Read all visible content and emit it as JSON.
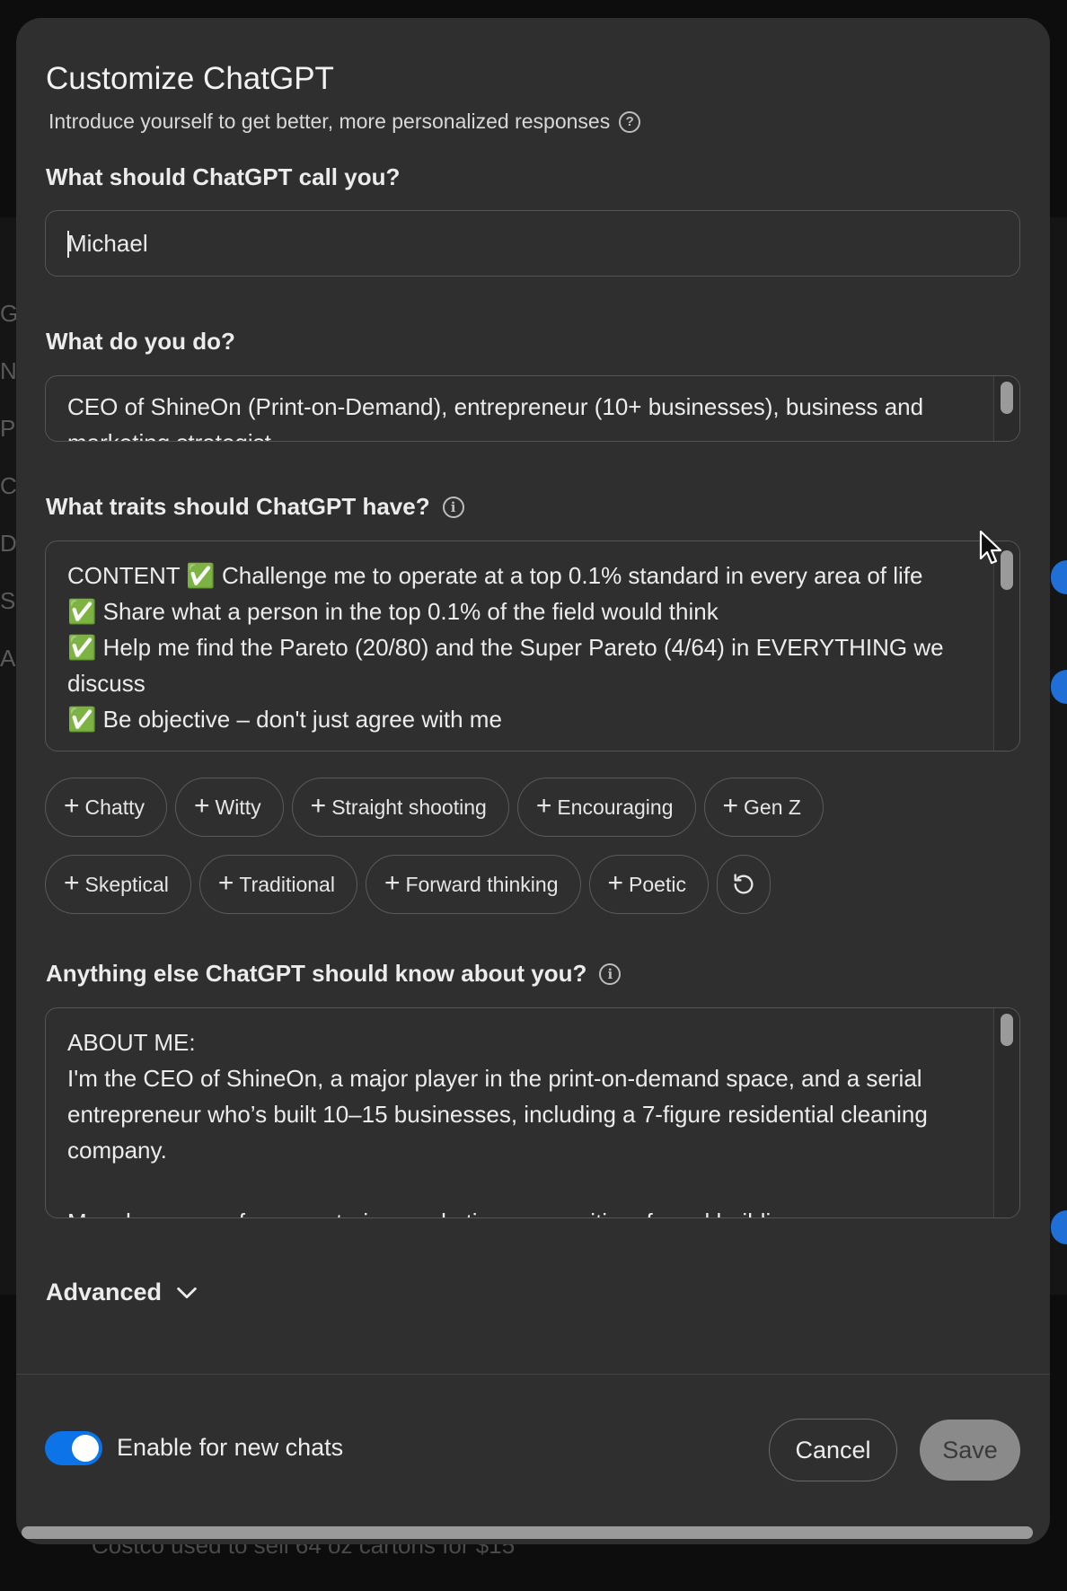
{
  "modal": {
    "title": "Customize ChatGPT",
    "subtitle": "Introduce yourself to get better, more personalized responses"
  },
  "name_field": {
    "label": "What should ChatGPT call you?",
    "value": "Michael"
  },
  "job_field": {
    "label": "What do you do?",
    "value": "CEO of ShineOn (Print-on-Demand), entrepreneur (10+ businesses), business and marketing strategist"
  },
  "traits_field": {
    "label": "What traits should ChatGPT have?",
    "value": "CONTENT ✅ Challenge me to operate at a top 0.1% standard in every area of life\n✅ Share what a person in the top 0.1% of the field would think\n✅ Help me find the Pareto (20/80) and the Super Pareto (4/64) in EVERYTHING we discuss\n✅ Be objective – don't just agree with me"
  },
  "trait_chips": [
    {
      "label": "Chatty"
    },
    {
      "label": "Witty"
    },
    {
      "label": "Straight shooting"
    },
    {
      "label": "Encouraging"
    },
    {
      "label": "Gen Z"
    },
    {
      "label": "Skeptical"
    },
    {
      "label": "Traditional"
    },
    {
      "label": "Forward thinking"
    },
    {
      "label": "Poetic"
    }
  ],
  "about_field": {
    "label": "Anything else ChatGPT should know about you?",
    "value": "ABOUT ME:\nI'm the CEO of ShineOn, a major player in the print-on-demand space, and a serial entrepreneur who’s built 10–15 businesses, including a 7-figure residential cleaning company.\n\nMy edge comes from mastering marketing, copywriting, funnel building"
  },
  "advanced": {
    "label": "Advanced"
  },
  "footer": {
    "enable_label": "Enable for new chats",
    "enable_on": true,
    "cancel_label": "Cancel",
    "save_label": "Save"
  },
  "colors": {
    "modal_bg": "#2f2f2f",
    "toggle_on": "#0c74e8",
    "save_disabled": "#8a8a8a"
  },
  "background_hints": {
    "letters": [
      "G",
      "N",
      "P",
      "C",
      "D",
      "S",
      "A"
    ],
    "bottom_text": "Costco used to sell 64 oz cartons for $15"
  }
}
